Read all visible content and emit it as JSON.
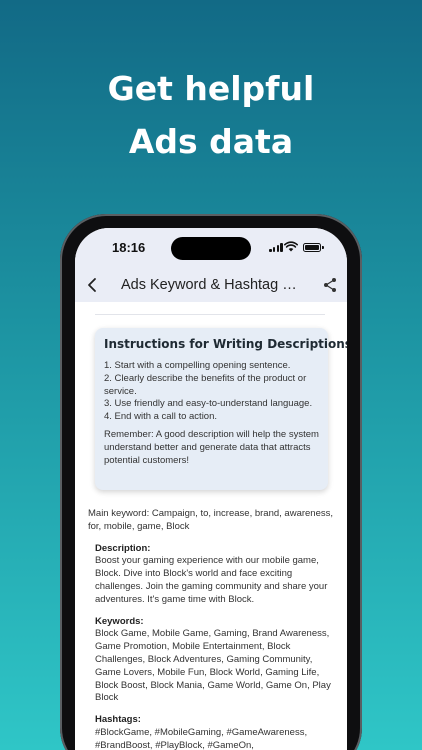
{
  "promo": {
    "headline_line1": "Get helpful",
    "headline_line2": "Ads data"
  },
  "status_bar": {
    "time": "18:16",
    "icons": [
      "cellular-signal-icon",
      "wifi-icon",
      "battery-icon"
    ]
  },
  "nav": {
    "back_icon": "chevron-left-icon",
    "title": "Ads Keyword & Hashtag Generator",
    "share_icon": "share-icon"
  },
  "instructions": {
    "title": "Instructions for Writing Descriptions",
    "steps": [
      "1. Start with a compelling opening sentence.",
      "2. Clearly describe the benefits of the product or service.",
      "3. Use friendly and easy-to-understand language.",
      "4. End with a call to action."
    ],
    "note": "Remember: A good description will help the system understand better and generate data that attracts potential customers!"
  },
  "result": {
    "main_keyword": "Main keyword: Campaign, to, increase, brand, awareness, for, mobile, game, Block",
    "description_label": "Description:",
    "description": "Boost your gaming experience with our mobile game, Block. Dive into Block's world and face exciting challenges. Join the gaming community and share your adventures. It's game time with Block.",
    "keywords_label": "Keywords:",
    "keywords": "Block Game, Mobile Game, Gaming, Brand Awareness, Game Promotion, Mobile Entertainment, Block Challenges, Block Adventures, Gaming Community, Game Lovers, Mobile Fun, Block World, Gaming Life, Block Boost, Block Mania, Game World, Game On, Play Block",
    "hashtags_label": "Hashtags:",
    "hashtags": "#BlockGame, #MobileGaming, #GameAwareness, #BrandBoost, #PlayBlock, #GameOn,"
  },
  "colors": {
    "bg_top": "#126a86",
    "bg_bottom": "#2fc6c7",
    "header_bg": "#eaedf6",
    "card_bg": "#e6edf6"
  }
}
